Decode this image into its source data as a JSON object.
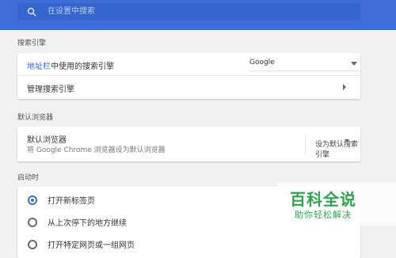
{
  "search": {
    "placeholder": "在设置中搜索",
    "icon": "search-icon"
  },
  "colors": {
    "accent": "#3f6fd6",
    "link": "#3367d6",
    "watermark": "#2fa34b"
  },
  "sections": {
    "search_engine": {
      "title": "搜索引擎",
      "address_bar_link": "地址栏",
      "address_bar_text": "中使用的搜索引擎",
      "engine_value": "Google",
      "manage_label": "管理搜索引擎"
    },
    "default_browser": {
      "title": "默认浏览器",
      "row_title": "默认浏览器",
      "row_subtitle": "将 Google Chrome 浏览器设为默认浏览器",
      "action": "设为默认搜索引擎"
    },
    "startup": {
      "title": "启动时",
      "options": [
        {
          "label": "打开新标签页",
          "checked": true
        },
        {
          "label": "从上次停下的地方继续",
          "checked": false
        },
        {
          "label": "打开特定网页或一组网页",
          "checked": false
        }
      ]
    }
  },
  "watermark": {
    "title": "百科全说",
    "subtitle": "助你轻松解决"
  }
}
